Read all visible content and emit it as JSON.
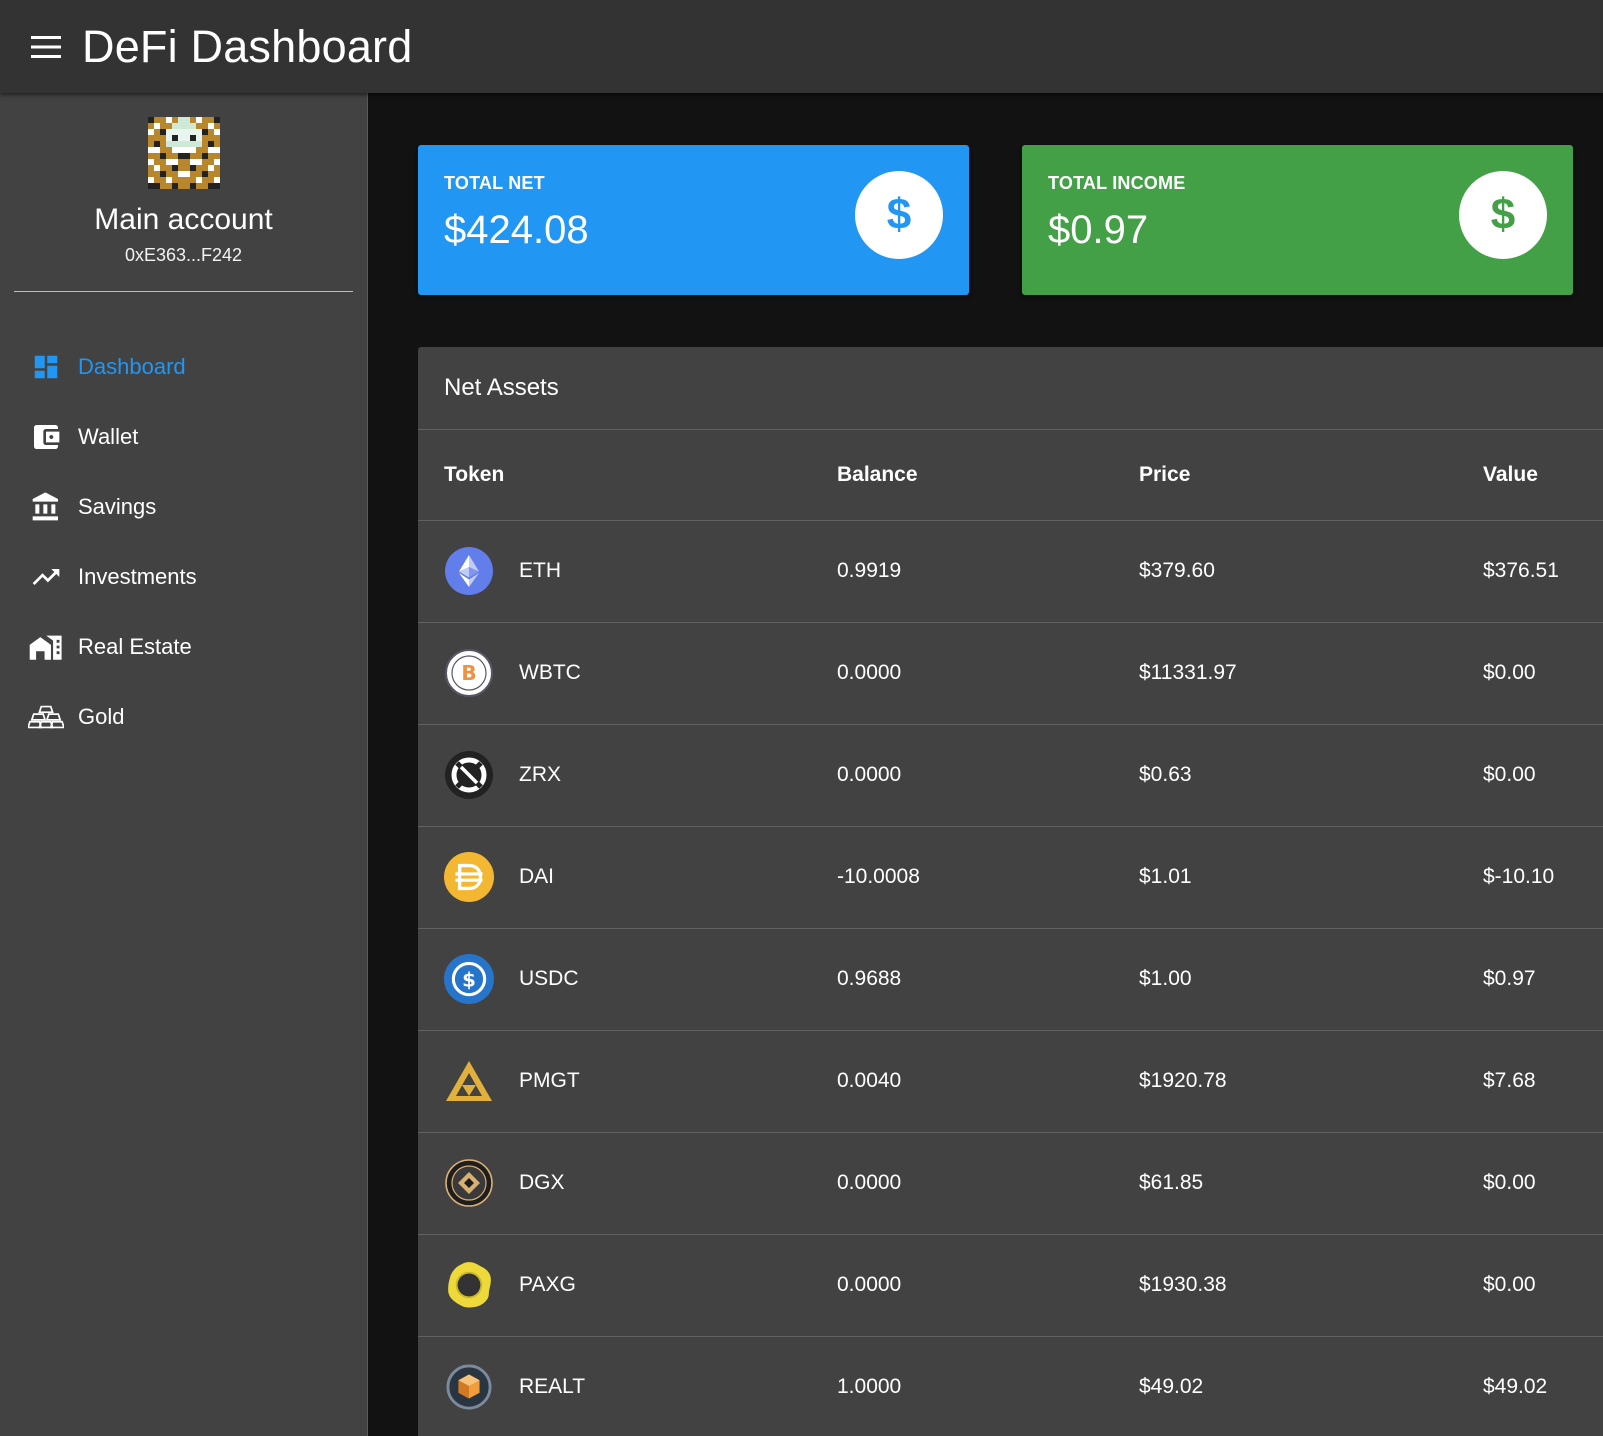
{
  "app": {
    "title": "DeFi Dashboard"
  },
  "profile": {
    "name": "Main account",
    "address": "0xE363...F242"
  },
  "nav": [
    {
      "label": "Dashboard",
      "icon": "dashboard-icon",
      "active": true
    },
    {
      "label": "Wallet",
      "icon": "wallet-icon"
    },
    {
      "label": "Savings",
      "icon": "bank-icon"
    },
    {
      "label": "Investments",
      "icon": "trending-up-icon"
    },
    {
      "label": "Real Estate",
      "icon": "buildings-icon"
    },
    {
      "label": "Gold",
      "icon": "gold-bars-icon"
    }
  ],
  "stats": {
    "net": {
      "label": "TOTAL NET",
      "value": "$424.08",
      "color": "#2196f3"
    },
    "income": {
      "label": "TOTAL INCOME",
      "value": "$0.97",
      "color": "#43a047"
    },
    "badge_symbol": "$"
  },
  "assets": {
    "title": "Net Assets",
    "columns": [
      "Token",
      "Balance",
      "Price",
      "Value"
    ],
    "rows": [
      {
        "token": "ETH",
        "balance": "0.9919",
        "price": "$379.60",
        "value": "$376.51"
      },
      {
        "token": "WBTC",
        "balance": "0.0000",
        "price": "$11331.97",
        "value": "$0.00"
      },
      {
        "token": "ZRX",
        "balance": "0.0000",
        "price": "$0.63",
        "value": "$0.00"
      },
      {
        "token": "DAI",
        "balance": "-10.0008",
        "price": "$1.01",
        "value": "$-10.10"
      },
      {
        "token": "USDC",
        "balance": "0.9688",
        "price": "$1.00",
        "value": "$0.97"
      },
      {
        "token": "PMGT",
        "balance": "0.0040",
        "price": "$1920.78",
        "value": "$7.68"
      },
      {
        "token": "DGX",
        "balance": "0.0000",
        "price": "$61.85",
        "value": "$0.00"
      },
      {
        "token": "PAXG",
        "balance": "0.0000",
        "price": "$1930.38",
        "value": "$0.00"
      },
      {
        "token": "REALT",
        "balance": "1.0000",
        "price": "$49.02",
        "value": "$49.02"
      }
    ]
  },
  "colors": {
    "accent": "#2196f3",
    "appbar": "#333333",
    "sidebar": "#424242",
    "background": "#121212"
  }
}
